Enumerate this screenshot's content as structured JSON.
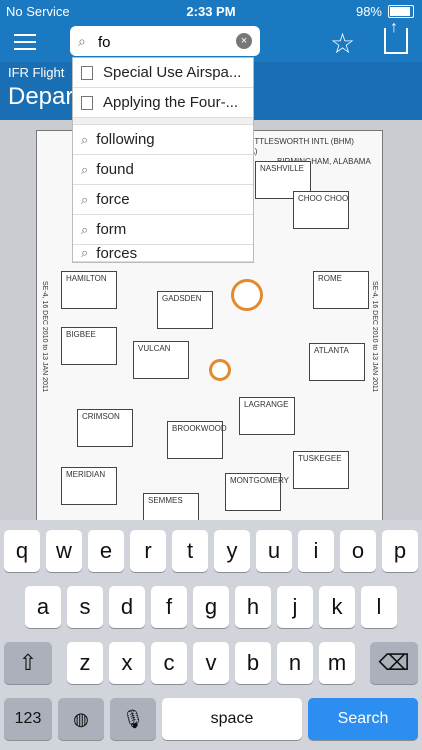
{
  "status": {
    "carrier": "No Service",
    "time": "2:33 PM",
    "battery": "98%"
  },
  "nav": {
    "search_value": "fo",
    "title_small": "IFR Flight",
    "title_big": "Depar                     DPs)"
  },
  "chart_text": {
    "airport": "BHM-SHUTTLESWORTH INTL (BHM)",
    "location": "BIRMINGHAM, ALABAMA",
    "faa": "(FAA)",
    "dates": "SE-4, 16 DEC 2010 to 13 JAN 2011",
    "stations": [
      "NASHVILLE",
      "CHOO CHOO",
      "HAMILTON",
      "GADSDEN",
      "ROME",
      "BIGBEE",
      "VULCAN",
      "ATLANTA",
      "LAGRANGE",
      "CRIMSON",
      "BROOKWOOD",
      "MERIDIAN",
      "SEMMES",
      "MONTGOMERY",
      "TUSKEGEE"
    ]
  },
  "suggestions": {
    "documents": [
      "Special Use Airspa...",
      "Applying the Four-..."
    ],
    "words": [
      "following",
      "found",
      "force",
      "form",
      "forces"
    ]
  },
  "keyboard": {
    "row1": [
      "q",
      "w",
      "e",
      "r",
      "t",
      "y",
      "u",
      "i",
      "o",
      "p"
    ],
    "row2": [
      "a",
      "s",
      "d",
      "f",
      "g",
      "h",
      "j",
      "k",
      "l"
    ],
    "row3": [
      "z",
      "x",
      "c",
      "v",
      "b",
      "n",
      "m"
    ],
    "numbers": "123",
    "space": "space",
    "search": "Search"
  },
  "colors": {
    "header": "#1b79c2",
    "accent": "#2b8ef0",
    "pin": "#e28a2f"
  },
  "icons": [
    "menu-icon",
    "search-icon",
    "clear-icon",
    "star-add-icon",
    "share-icon",
    "shift-icon",
    "backspace-icon",
    "globe-icon",
    "mic-icon"
  ]
}
